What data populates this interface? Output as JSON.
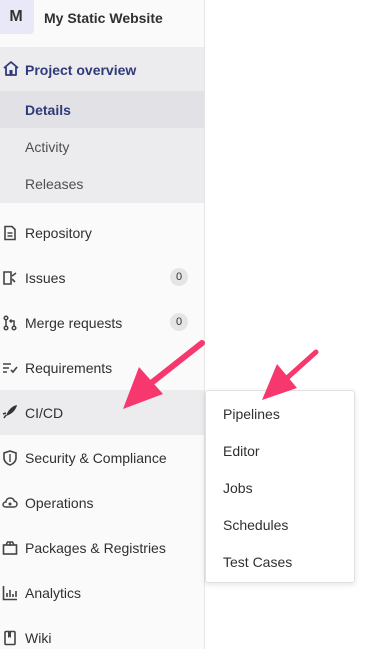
{
  "header": {
    "avatar_letter": "M",
    "title": "My Static Website"
  },
  "nav": {
    "overview": {
      "label": "Project overview",
      "icon": "home-icon"
    },
    "sub_items": [
      {
        "label": "Details",
        "active": true
      },
      {
        "label": "Activity",
        "active": false
      },
      {
        "label": "Releases",
        "active": false
      }
    ],
    "items": [
      {
        "label": "Repository",
        "icon": "doc-icon"
      },
      {
        "label": "Issues",
        "icon": "issues-icon",
        "badge": "0"
      },
      {
        "label": "Merge requests",
        "icon": "merge-icon",
        "badge": "0"
      },
      {
        "label": "Requirements",
        "icon": "requirements-icon"
      },
      {
        "label": "CI/CD",
        "icon": "rocket-icon",
        "active": true
      },
      {
        "label": "Security & Compliance",
        "icon": "shield-icon"
      },
      {
        "label": "Operations",
        "icon": "cloud-icon"
      },
      {
        "label": "Packages & Registries",
        "icon": "package-icon"
      },
      {
        "label": "Analytics",
        "icon": "chart-icon"
      },
      {
        "label": "Wiki",
        "icon": "book-icon"
      }
    ]
  },
  "flyout": {
    "items": [
      "Pipelines",
      "Editor",
      "Jobs",
      "Schedules",
      "Test Cases"
    ]
  },
  "colors": {
    "accent": "#303a7a",
    "arrow": "#f7386e",
    "sidebar_bg": "#fafafa"
  }
}
